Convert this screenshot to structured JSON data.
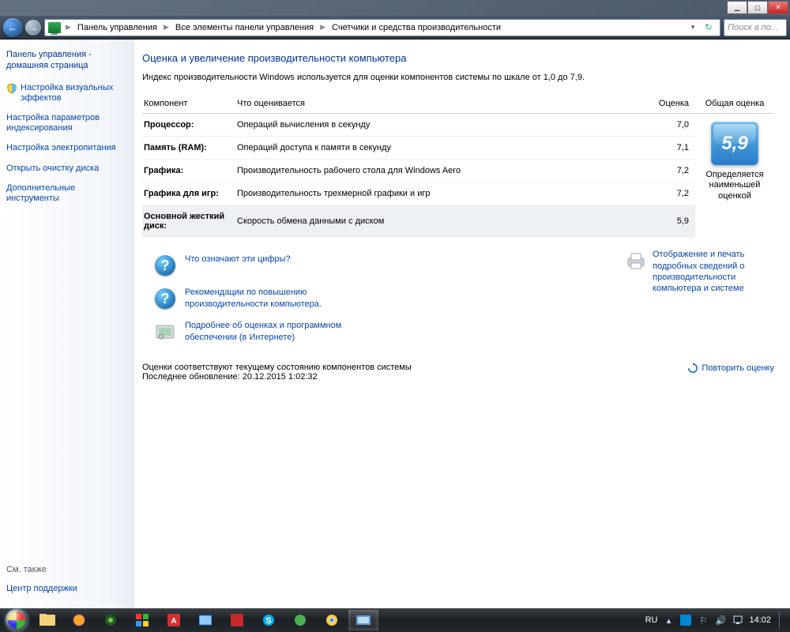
{
  "window": {
    "min": "",
    "max": "",
    "close": ""
  },
  "nav": {
    "back": "←",
    "forward": "→",
    "refresh": "↻",
    "search_placeholder": "Поиск в по..."
  },
  "breadcrumb": {
    "items": [
      "Панель управления",
      "Все элементы панели управления",
      "Счетчики и средства производительности"
    ]
  },
  "sidebar": {
    "home": "Панель управления - домашняя страница",
    "items": [
      {
        "label": "Настройка визуальных эффектов",
        "shield": true
      },
      {
        "label": "Настройка параметров индексирования",
        "shield": false
      },
      {
        "label": "Настройка электропитания",
        "shield": false
      },
      {
        "label": "Открыть очистку диска",
        "shield": false
      },
      {
        "label": "Дополнительные инструменты",
        "shield": false
      }
    ],
    "see_also_header": "См. также",
    "see_also": [
      "Центр поддержки"
    ]
  },
  "content": {
    "title": "Оценка и увеличение производительности компьютера",
    "intro": "Индекс производительности Windows используется для оценки компонентов системы по шкале от 1,0 до 7,9.",
    "headers": {
      "component": "Компонент",
      "desc": "Что оценивается",
      "score": "Оценка",
      "overall": "Общая оценка"
    },
    "rows": [
      {
        "comp": "Процессор:",
        "desc": "Операций вычисления в секунду",
        "score": "7,0"
      },
      {
        "comp": "Память (RAM):",
        "desc": "Операций доступа к памяти в секунду",
        "score": "7,1"
      },
      {
        "comp": "Графика:",
        "desc": "Производительность рабочего стола для Windows Aero",
        "score": "7,2"
      },
      {
        "comp": "Графика для игр:",
        "desc": "Производительность трехмерной графики и игр",
        "score": "7,2"
      },
      {
        "comp": "Основной жесткий диск:",
        "desc": "Скорость обмена данными с диском",
        "score": "5,9",
        "highlight": true
      }
    ],
    "overall_score": "5,9",
    "overall_caption": "Определяется наименьшей оценкой",
    "help_links": [
      "Что означают эти цифры?",
      "Рекомендации по повышению производительности компьютера."
    ],
    "software_link": "Подробнее об оценках и программном обеспечении (в Интернете)",
    "print_link": "Отображение и печать подробных сведений о производительности компьютера и системе",
    "status1": "Оценки соответствуют текущему состоянию компонентов системы",
    "status2": "Последнее обновление: 20.12.2015 1:02:32",
    "rerun": "Повторить оценку"
  },
  "taskbar": {
    "lang": "RU",
    "time": "14:02"
  }
}
